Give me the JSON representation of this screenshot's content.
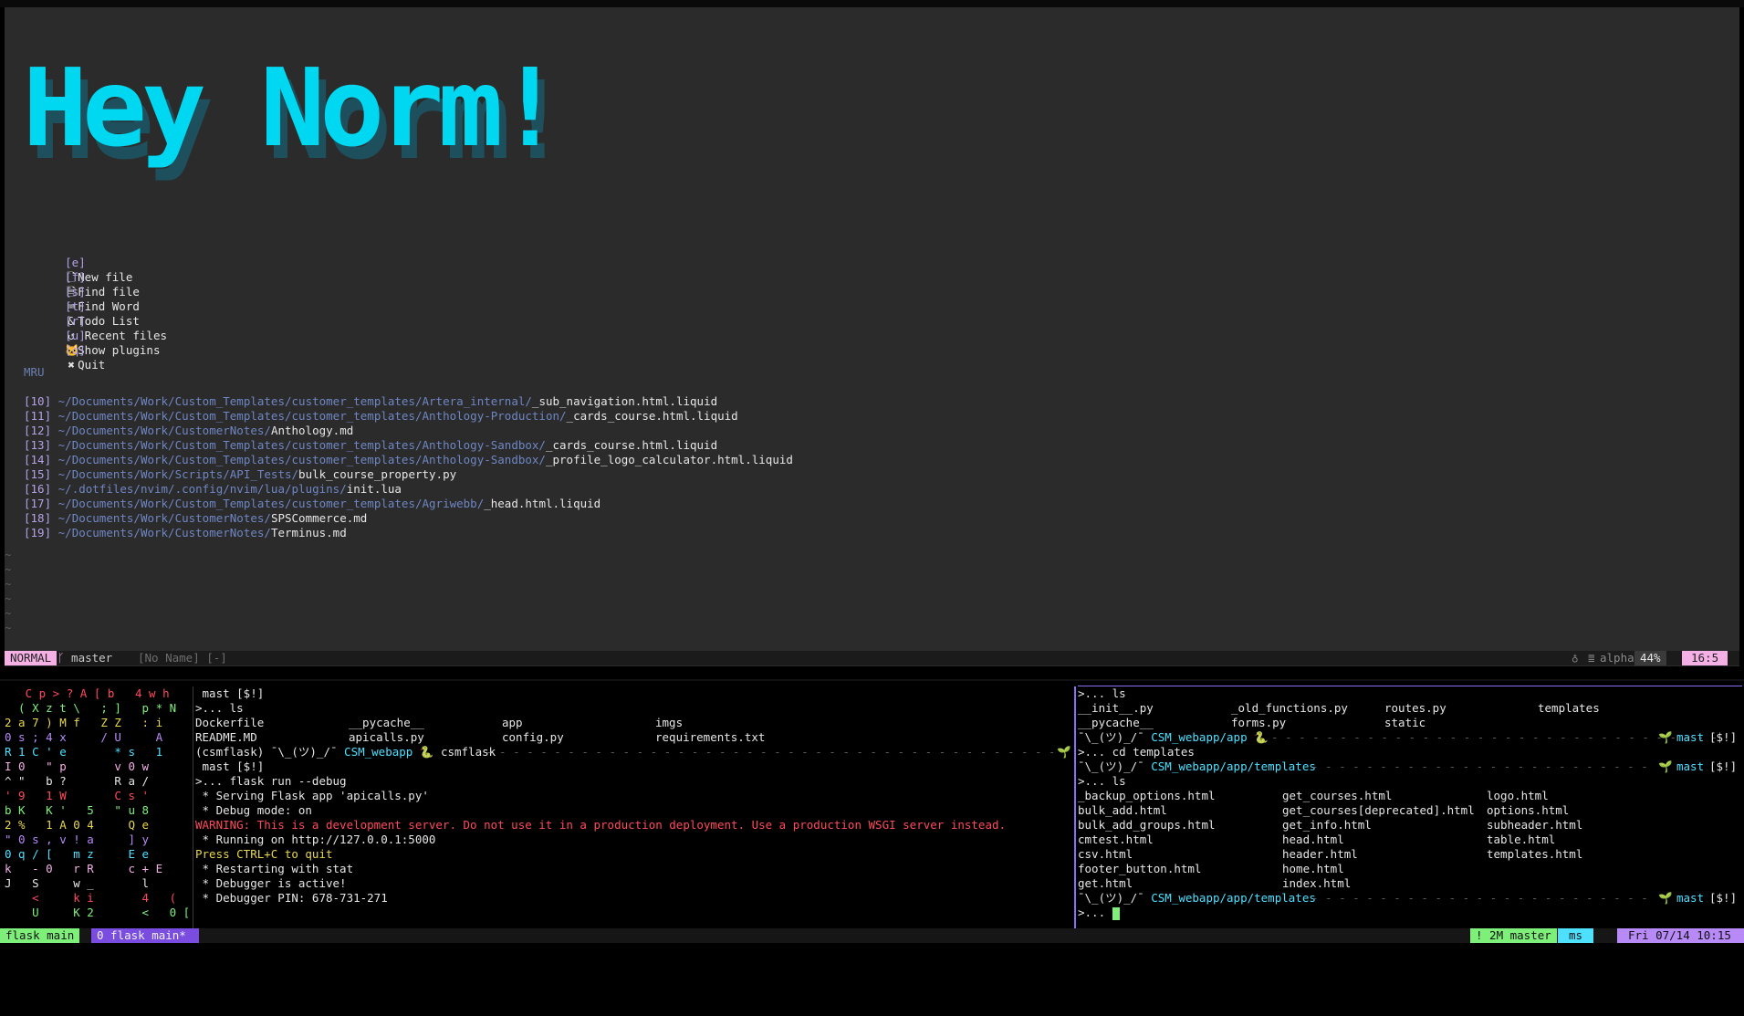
{
  "banner": {
    "text": "Hey Norm!",
    "color": "#00d7f0",
    "shadow_color": "#1e4f5c"
  },
  "dashboard": {
    "items": [
      {
        "key": "[e]",
        "icon": "new-file-icon",
        "glyph": "🗋",
        "label": "New file"
      },
      {
        "key": "[f]",
        "icon": "find-file-icon",
        "glyph": "🗎",
        "label": "Find file"
      },
      {
        "key": "[s]",
        "icon": "find-word-icon",
        "glyph": "⌨",
        "label": "Find Word"
      },
      {
        "key": "[t]",
        "icon": "todo-icon",
        "glyph": "&",
        "label": "Todo List"
      },
      {
        "key": "[r]",
        "icon": "recent-files-icon",
        "glyph": "↺",
        "label": " Recent files"
      },
      {
        "key": "[u]",
        "icon": "plugins-icon",
        "glyph": "🐱",
        "label": "Show plugins"
      },
      {
        "key": "[q]",
        "icon": "quit-icon",
        "glyph": "✖",
        "label": "Quit"
      }
    ],
    "mru_title": "MRU",
    "mru": [
      {
        "idx": "[10]",
        "dir": "~/Documents/Work/Custom_Templates/customer_templates/Artera_internal/",
        "file": "_sub_navigation.html.liquid"
      },
      {
        "idx": "[11]",
        "dir": "~/Documents/Work/Custom_Templates/customer_templates/Anthology-Production/",
        "file": "_cards_course.html.liquid"
      },
      {
        "idx": "[12]",
        "dir": "~/Documents/Work/CustomerNotes/",
        "file": "Anthology.md"
      },
      {
        "idx": "[13]",
        "dir": "~/Documents/Work/Custom_Templates/customer_templates/Anthology-Sandbox/",
        "file": "_cards_course.html.liquid"
      },
      {
        "idx": "[14]",
        "dir": "~/Documents/Work/Custom_Templates/customer_templates/Anthology-Sandbox/",
        "file": "_profile_logo_calculator.html.liquid"
      },
      {
        "idx": "[15]",
        "dir": "~/Documents/Work/Scripts/API_Tests/",
        "file": "bulk_course_property.py"
      },
      {
        "idx": "[16]",
        "dir": "~/.dotfiles/nvim/.config/nvim/lua/plugins/",
        "file": "init.lua"
      },
      {
        "idx": "[17]",
        "dir": "~/Documents/Work/Custom_Templates/customer_templates/Agriwebb/",
        "file": "_head.html.liquid"
      },
      {
        "idx": "[18]",
        "dir": "~/Documents/Work/CustomerNotes/",
        "file": "SPSCommerce.md"
      },
      {
        "idx": "[19]",
        "dir": "~/Documents/Work/CustomerNotes/",
        "file": "Terminus.md"
      }
    ]
  },
  "statusline": {
    "mode": "NORMAL",
    "branch_icon": "ᚴ",
    "branch": "master",
    "filename": "[No Name] [-]",
    "lsp_icon": "♁",
    "filetype": "alpha",
    "percent": "44%",
    "position": "16:5",
    "mode_color": "#f5b0e5"
  },
  "matrix": {
    "rows": [
      "   C p > ? A [ b   4 w h",
      "  ( X z t \\   ; ]   p * N",
      "2 a 7 ) M f   Z Z   : i",
      "0 s ; 4 x     / U     A",
      "R 1 C ' e       * s   1",
      "I 0   \" p       v 0 w",
      "^ \"   b ?       R a /",
      "' 9   1 W       C s '",
      "b K   K '   5   \" u 8",
      "2 %   1 A 0 4     Q e",
      "\" 0 s , v ! a     ] y",
      "0 q / [   m z     E e",
      "k   - 0   r R     c + E",
      "J   S     w _       l",
      "    <     k i       4   (",
      "    U     K 2       <   0 ["
    ]
  },
  "pane2": {
    "prompt1": " mast [$!]",
    "cmd_ls": ">... ls",
    "ls_cols": [
      [
        "Dockerfile",
        "__pycache__",
        "app",
        "imgs"
      ],
      [
        "README.MD",
        "apicalls.py",
        "config.py",
        "requirements.txt"
      ]
    ],
    "venv": "(csmflask)",
    "shrug": "¯\\_(ツ)_/¯",
    "dir": "CSM_webapp",
    "snake": "🐍",
    "env": "csmflask",
    "leaf": "🌱",
    "prompt2": " mast [$!]",
    "cmd_run": ">... flask run --debug",
    "out1": " * Serving Flask app 'apicalls.py'",
    "out2": " * Debug mode: on",
    "warning": "WARNING: This is a development server. Do not use it in a production deployment. Use a production WSGI server instead.",
    "out3": " * Running on http://127.0.0.1:5000",
    "ctrlc": "Press CTRL+C to quit",
    "out4": " * Restarting with stat",
    "out5": " * Debugger is active!",
    "out6": " * Debugger PIN: 678-731-271"
  },
  "pane3": {
    "cmd_ls": ">... ls",
    "ls_cols": [
      [
        "__init__.py",
        "_old_functions.py",
        "routes.py",
        "templates"
      ],
      [
        "__pycache__",
        "forms.py",
        "static",
        ""
      ]
    ],
    "shrug": "¯\\_(ツ)_/¯",
    "dir_app": "CSM_webapp/app",
    "snake": "🐍",
    "leaf": "🌱",
    "branch": "mast",
    "status": "[$!]",
    "cmd_cd": ">... cd templates",
    "dir_templates": "CSM_webapp/app/templates",
    "cmd_ls2": ">... ls",
    "tpl_rows": [
      [
        "_backup_options.html",
        "get_courses.html",
        "logo.html"
      ],
      [
        "bulk_add.html",
        "get_courses[deprecated].html",
        "options.html"
      ],
      [
        "bulk_add_groups.html",
        "get_info.html",
        "subheader.html"
      ],
      [
        "cmtest.html",
        "head.html",
        "table.html"
      ],
      [
        "csv.html",
        "header.html",
        "templates.html"
      ],
      [
        "footer_button.html",
        "home.html",
        ""
      ],
      [
        "get.html",
        "index.html",
        ""
      ]
    ],
    "prompt_last": ">..."
  },
  "tmux": {
    "session": "flask main",
    "window": "0 flask main*",
    "git": "! 2M master",
    "user": "ms",
    "datetime": "Fri 07/14 10:15"
  }
}
